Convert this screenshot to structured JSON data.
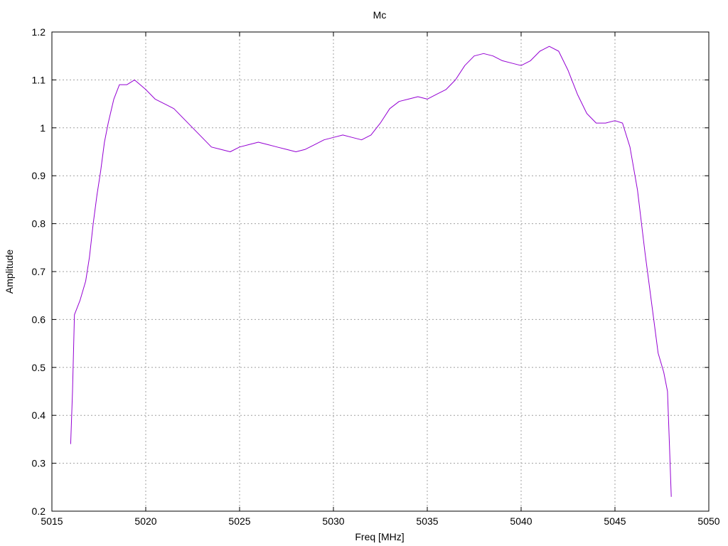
{
  "chart_data": {
    "type": "line",
    "title": "Mc",
    "xlabel": "Freq [MHz]",
    "ylabel": "Amplitude",
    "xlim": [
      5015,
      5050
    ],
    "ylim": [
      0.2,
      1.2
    ],
    "xticks": [
      5015,
      5020,
      5025,
      5030,
      5035,
      5040,
      5045,
      5050
    ],
    "yticks": [
      0.2,
      0.3,
      0.4,
      0.5,
      0.6,
      0.7,
      0.8,
      0.9,
      1,
      1.1,
      1.2
    ],
    "grid": true,
    "legend": "none",
    "series": [
      {
        "color": "#9400d3",
        "x": [
          5016.0,
          5016.1,
          5016.2,
          5016.5,
          5016.8,
          5017.0,
          5017.2,
          5017.4,
          5017.6,
          5017.8,
          5018.0,
          5018.3,
          5018.6,
          5019.0,
          5019.4,
          5020.0,
          5020.5,
          5021.0,
          5021.5,
          5022.0,
          5022.5,
          5023.0,
          5023.5,
          5024.0,
          5024.5,
          5025.0,
          5025.5,
          5026.0,
          5026.5,
          5027.0,
          5027.5,
          5028.0,
          5028.5,
          5029.0,
          5029.5,
          5030.0,
          5030.5,
          5031.0,
          5031.5,
          5032.0,
          5032.5,
          5033.0,
          5033.5,
          5034.0,
          5034.5,
          5035.0,
          5035.5,
          5036.0,
          5036.5,
          5037.0,
          5037.5,
          5038.0,
          5038.5,
          5039.0,
          5039.5,
          5040.0,
          5040.5,
          5041.0,
          5041.5,
          5042.0,
          5042.5,
          5043.0,
          5043.5,
          5044.0,
          5044.5,
          5045.0,
          5045.4,
          5045.8,
          5046.2,
          5046.6,
          5047.0,
          5047.3,
          5047.6,
          5047.8,
          5047.9,
          5048.0
        ],
        "y": [
          0.34,
          0.45,
          0.61,
          0.64,
          0.68,
          0.73,
          0.8,
          0.86,
          0.91,
          0.97,
          1.01,
          1.06,
          1.09,
          1.09,
          1.1,
          1.08,
          1.06,
          1.05,
          1.04,
          1.02,
          1.0,
          0.98,
          0.96,
          0.955,
          0.95,
          0.96,
          0.965,
          0.97,
          0.965,
          0.96,
          0.955,
          0.95,
          0.955,
          0.965,
          0.975,
          0.98,
          0.985,
          0.98,
          0.975,
          0.985,
          1.01,
          1.04,
          1.055,
          1.06,
          1.065,
          1.06,
          1.07,
          1.08,
          1.1,
          1.13,
          1.15,
          1.155,
          1.15,
          1.14,
          1.135,
          1.13,
          1.14,
          1.16,
          1.17,
          1.16,
          1.12,
          1.07,
          1.03,
          1.01,
          1.01,
          1.015,
          1.01,
          0.96,
          0.87,
          0.74,
          0.62,
          0.53,
          0.49,
          0.45,
          0.34,
          0.23
        ]
      }
    ]
  }
}
